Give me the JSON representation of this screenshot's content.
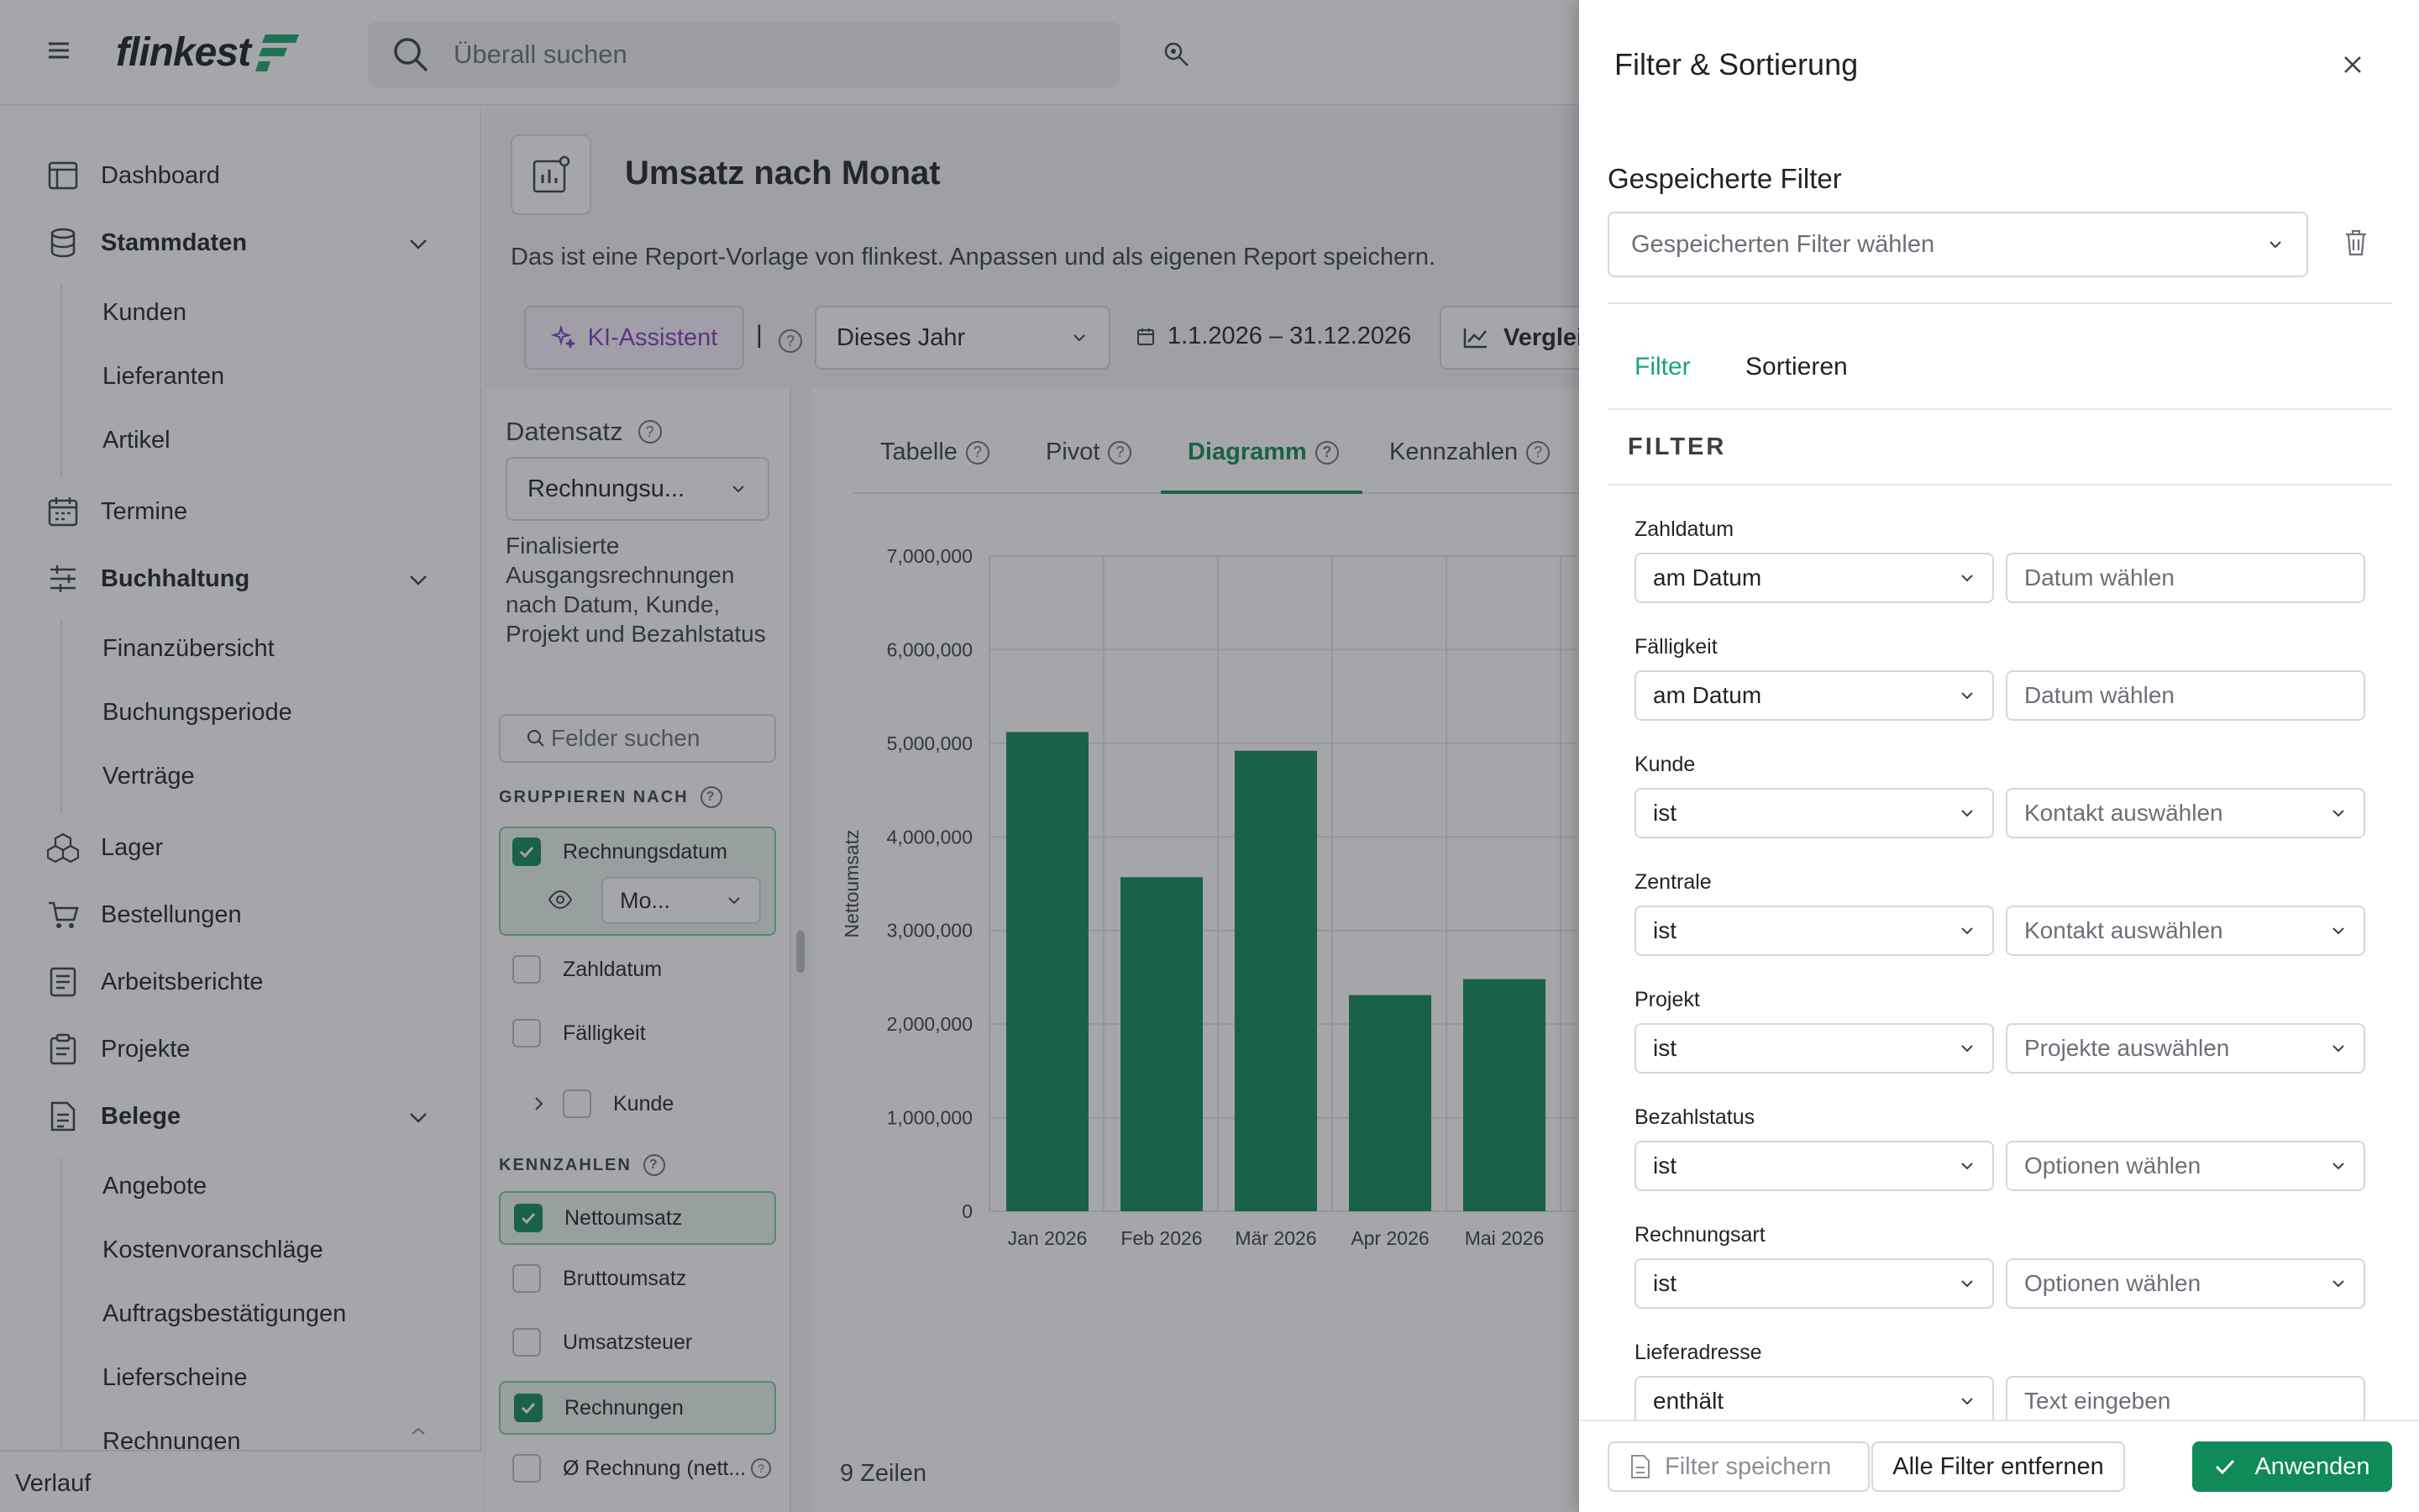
{
  "app": {
    "logo_text": "flinkest",
    "search_placeholder": "Überall suchen"
  },
  "sidebar": {
    "items": [
      {
        "label": "Dashboard",
        "icon": "dashboard-icon"
      },
      {
        "label": "Stammdaten",
        "icon": "database-icon",
        "expanded": true
      },
      {
        "label": "Kunden"
      },
      {
        "label": "Lieferanten"
      },
      {
        "label": "Artikel"
      },
      {
        "label": "Termine",
        "icon": "calendar-icon"
      },
      {
        "label": "Buchhaltung",
        "icon": "sliders-icon",
        "expanded": true
      },
      {
        "label": "Finanzübersicht"
      },
      {
        "label": "Buchungsperiode"
      },
      {
        "label": "Verträge"
      },
      {
        "label": "Lager",
        "icon": "boxes-icon"
      },
      {
        "label": "Bestellungen",
        "icon": "cart-icon"
      },
      {
        "label": "Arbeitsberichte",
        "icon": "report-icon"
      },
      {
        "label": "Projekte",
        "icon": "clipboard-icon"
      },
      {
        "label": "Belege",
        "icon": "document-icon",
        "expanded": true
      },
      {
        "label": "Angebote"
      },
      {
        "label": "Kostenvoranschläge"
      },
      {
        "label": "Auftragsbestätigungen"
      },
      {
        "label": "Lieferscheine"
      },
      {
        "label": "Rechnungen"
      }
    ],
    "footer": "Verlauf"
  },
  "report": {
    "title": "Umsatz nach Monat",
    "description": "Das ist eine Report-Vorlage von flinkest. Anpassen und als eigenen Report speichern.",
    "ki_button": "KI-Assistent",
    "separator": "|",
    "period_select": "Dieses Jahr",
    "date_range": "1.1.2026 – 31.12.2026",
    "compare_button": "Verglei"
  },
  "dataset": {
    "title": "Datensatz",
    "select_value": "Rechnungsu...",
    "description": "Finalisierte Ausgangsrechnungen nach Datum, Kunde, Projekt und Bezahlstatus",
    "field_search_placeholder": "Felder suchen",
    "group_label": "GRUPPIEREN NACH",
    "group_fields": [
      {
        "label": "Rechnungsdatum",
        "checked": true
      },
      {
        "label": "Zahldatum",
        "checked": false
      },
      {
        "label": "Fälligkeit",
        "checked": false
      },
      {
        "label": "Kunde",
        "checked": false
      }
    ],
    "granularity": "Mo...",
    "kpi_label": "KENNZAHLEN",
    "kpi_fields": [
      {
        "label": "Nettoumsatz",
        "checked": true
      },
      {
        "label": "Bruttoumsatz",
        "checked": false
      },
      {
        "label": "Umsatzsteuer",
        "checked": false
      },
      {
        "label": "Rechnungen",
        "checked": true
      },
      {
        "label": "Ø Rechnung (nett...",
        "checked": false
      }
    ]
  },
  "view_tabs": [
    {
      "label": "Tabelle",
      "active": false
    },
    {
      "label": "Pivot",
      "active": false
    },
    {
      "label": "Diagramm",
      "active": true
    },
    {
      "label": "Kennzahlen",
      "active": false
    }
  ],
  "rows_count": "9 Zeilen",
  "chart_data": {
    "type": "bar",
    "categories": [
      "Jan 2026",
      "Feb 2026",
      "Mär 2026",
      "Apr 2026",
      "Mai 2026"
    ],
    "values": [
      5120000,
      3570000,
      4920000,
      2310000,
      2480000
    ],
    "ylabel": "Nettoumsatz",
    "ylim": [
      0,
      7000000
    ],
    "yticks": [
      "0",
      "1,000,000",
      "2,000,000",
      "3,000,000",
      "4,000,000",
      "5,000,000",
      "6,000,000",
      "7,000,000"
    ],
    "color": "#0f8a58",
    "grid": true
  },
  "drawer": {
    "title": "Filter & Sortierung",
    "saved_label": "Gespeicherte Filter",
    "saved_placeholder": "Gespeicherten Filter wählen",
    "tabs": [
      {
        "label": "Filter",
        "active": true
      },
      {
        "label": "Sortieren",
        "active": false
      }
    ],
    "filter_heading": "FILTER",
    "filters": [
      {
        "label": "Zahldatum",
        "op": "am Datum",
        "value": "Datum wählen",
        "value_dropdown": false
      },
      {
        "label": "Fälligkeit",
        "op": "am Datum",
        "value": "Datum wählen",
        "value_dropdown": false
      },
      {
        "label": "Kunde",
        "op": "ist",
        "value": "Kontakt auswählen",
        "value_dropdown": true
      },
      {
        "label": "Zentrale",
        "op": "ist",
        "value": "Kontakt auswählen",
        "value_dropdown": true
      },
      {
        "label": "Projekt",
        "op": "ist",
        "value": "Projekte auswählen",
        "value_dropdown": true
      },
      {
        "label": "Bezahlstatus",
        "op": "ist",
        "value": "Optionen wählen",
        "value_dropdown": true
      },
      {
        "label": "Rechnungsart",
        "op": "ist",
        "value": "Optionen wählen",
        "value_dropdown": true
      },
      {
        "label": "Lieferadresse",
        "op": "enthält",
        "value": "Text eingeben",
        "value_dropdown": false
      }
    ],
    "save_button": "Filter speichern",
    "clear_button": "Alle Filter entfernen",
    "apply_button": "Anwenden",
    "accent": "#0f8a58"
  }
}
